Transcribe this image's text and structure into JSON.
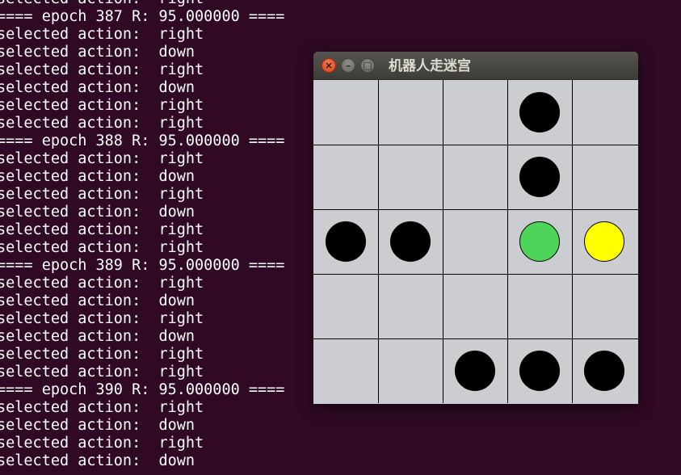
{
  "terminal": {
    "lines": [
      "selected action:  right",
      "==== epoch 387 R: 95.000000 ====",
      "selected action:  right",
      "selected action:  down",
      "selected action:  right",
      "selected action:  down",
      "selected action:  right",
      "selected action:  right",
      "==== epoch 388 R: 95.000000 ====",
      "selected action:  right",
      "selected action:  down",
      "selected action:  right",
      "selected action:  down",
      "selected action:  right",
      "selected action:  right",
      "==== epoch 389 R: 95.000000 ====",
      "selected action:  right",
      "selected action:  down",
      "selected action:  right",
      "selected action:  down",
      "selected action:  right",
      "selected action:  right",
      "==== epoch 390 R: 95.000000 ====",
      "selected action:  right",
      "selected action:  down",
      "selected action:  right",
      "selected action:  down"
    ]
  },
  "window": {
    "title": "机器人走迷宫",
    "close_icon": "×",
    "minimize_icon": "–",
    "maximize_icon": "□"
  },
  "maze": {
    "rows": 5,
    "cols": 5,
    "colors": {
      "obstacle": "#000000",
      "robot": "#4ed35b",
      "goal": "#ffff00"
    },
    "pieces": [
      {
        "row": 0,
        "col": 3,
        "kind": "obstacle"
      },
      {
        "row": 1,
        "col": 3,
        "kind": "obstacle"
      },
      {
        "row": 2,
        "col": 0,
        "kind": "obstacle"
      },
      {
        "row": 2,
        "col": 1,
        "kind": "obstacle"
      },
      {
        "row": 2,
        "col": 3,
        "kind": "robot"
      },
      {
        "row": 2,
        "col": 4,
        "kind": "goal"
      },
      {
        "row": 4,
        "col": 2,
        "kind": "obstacle"
      },
      {
        "row": 4,
        "col": 3,
        "kind": "obstacle"
      },
      {
        "row": 4,
        "col": 4,
        "kind": "obstacle"
      }
    ]
  }
}
